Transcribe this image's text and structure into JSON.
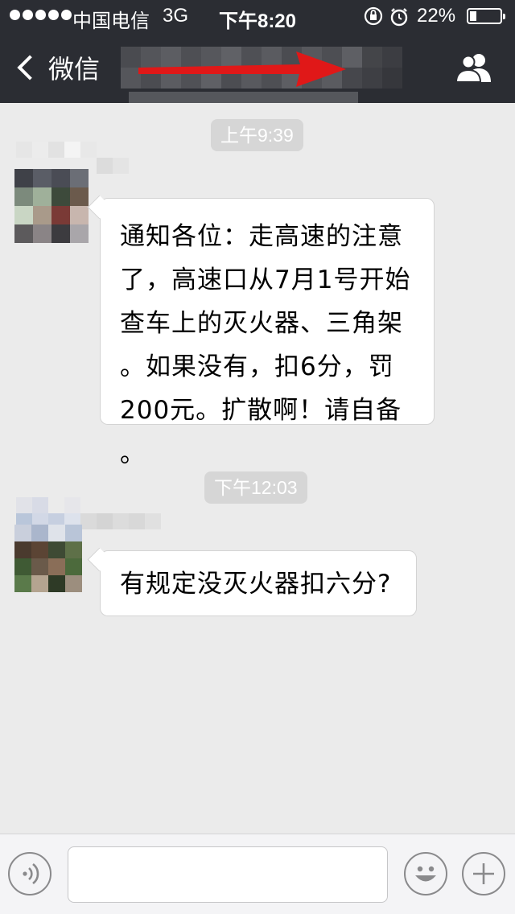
{
  "status_bar": {
    "carrier": "中国电信",
    "network": "3G",
    "time": "下午8:20",
    "battery_percent": "22%",
    "battery_level": 0.22,
    "icons": [
      "orientation-lock-icon",
      "alarm-icon"
    ]
  },
  "nav": {
    "back_label": "微信",
    "contacts_icon": "contacts-icon",
    "title_obscured": true,
    "annotation": "red-arrow"
  },
  "messages": [
    {
      "timestamp": "上午9:39",
      "text": "通知各位：走高速的注意\n了，高速口从7月1号开始\n查车上的灭火器、三角架\n。如果没有，扣6分，罚\n200元。扩散啊！请自备\n。"
    },
    {
      "timestamp": "下午12:03",
      "text": "有规定没灭火器扣六分?"
    }
  ],
  "input_bar": {
    "voice_icon": "voice-icon",
    "emoji_icon": "emoji-icon",
    "plus_icon": "plus-icon",
    "input_value": ""
  },
  "colors": {
    "nav_background": "#2b2d33",
    "chat_background": "#ebebeb",
    "timestamp_background": "#d6d6d6",
    "bubble_background": "#ffffff",
    "annotation_red": "#e01818"
  }
}
